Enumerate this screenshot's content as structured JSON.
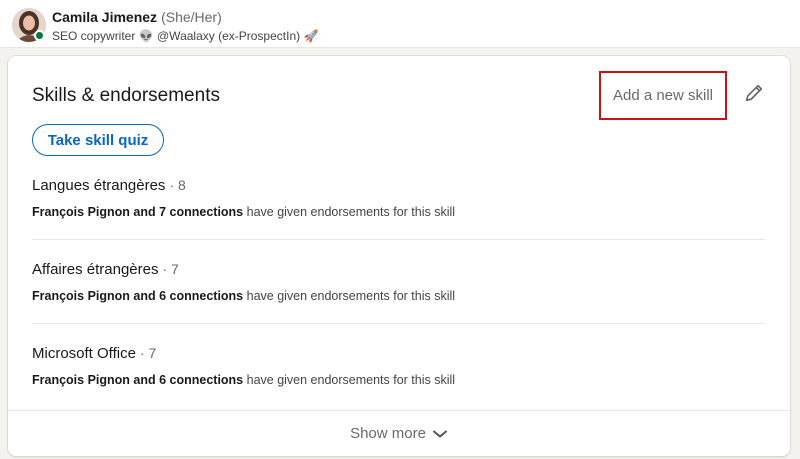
{
  "profile": {
    "name": "Camila Jimenez",
    "pronouns": "(She/Her)",
    "headline_part1": "SEO copywriter",
    "headline_emoji1": "👽",
    "headline_part2": "@Waalaxy (ex-ProspectIn)",
    "headline_emoji2": "🚀"
  },
  "card": {
    "title": "Skills & endorsements",
    "add_skill_label": "Add a new skill",
    "quiz_label": "Take skill quiz",
    "show_more_label": "Show more"
  },
  "skills": [
    {
      "name": "Langues étrangères",
      "separator": "·",
      "count": "8",
      "endorsers": "François Pignon and 7 connections",
      "endorse_text": "have given endorsements for this skill"
    },
    {
      "name": "Affaires étrangères",
      "separator": "·",
      "count": "7",
      "endorsers": "François Pignon and 6 connections",
      "endorse_text": "have given endorsements for this skill"
    },
    {
      "name": "Microsoft Office",
      "separator": "·",
      "count": "7",
      "endorsers": "François Pignon and 6 connections",
      "endorse_text": "have given endorsements for this skill"
    }
  ],
  "icons": {
    "edit": "pencil-icon",
    "show_more": "chevron-down-icon",
    "status": "online-status-icon"
  },
  "colors": {
    "accent": "#0a66c2",
    "highlight_border": "#cc1016",
    "online": "#057642"
  }
}
